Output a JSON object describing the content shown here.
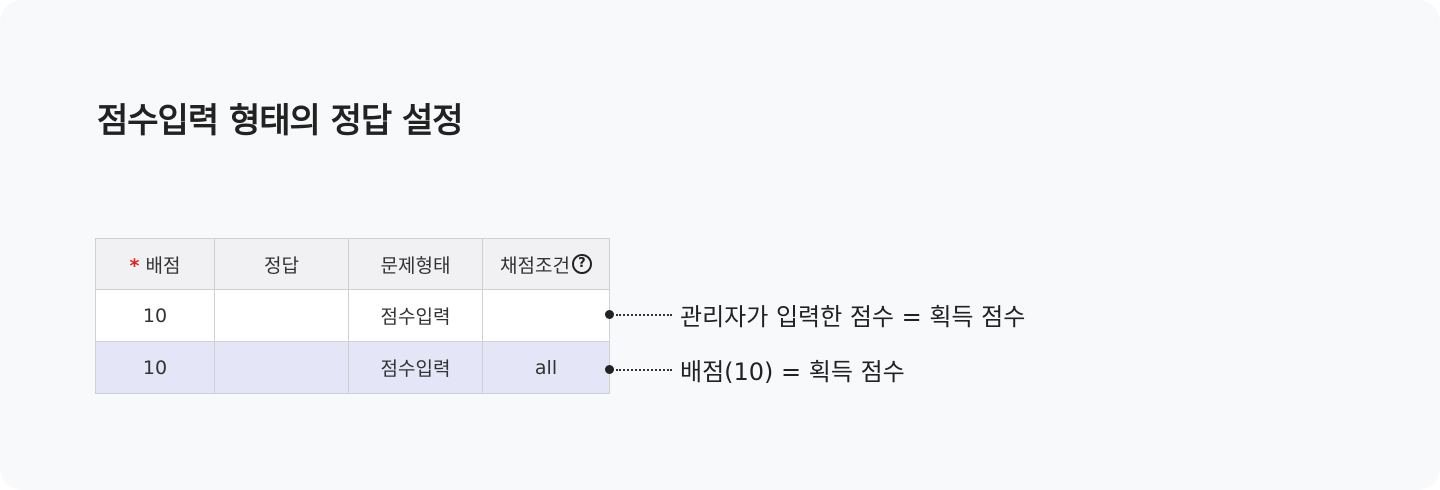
{
  "title": "점수입력 형태의 정답 설정",
  "table": {
    "required_mark": "*",
    "headers": [
      "배점",
      "정답",
      "문제형태",
      "채점조건"
    ],
    "help_icon": "question-circle-icon",
    "rows": [
      {
        "score": "10",
        "answer": "",
        "type": "점수입력",
        "condition": ""
      },
      {
        "score": "10",
        "answer": "",
        "type": "점수입력",
        "condition": "all"
      }
    ]
  },
  "notes": [
    "관리자가 입력한 점수 = 획득 점수",
    "배점(10) = 획득 점수"
  ],
  "colors": {
    "highlight_row": "#e5e5f8",
    "required": "#e02020",
    "header_bg": "#f1f1f4"
  }
}
